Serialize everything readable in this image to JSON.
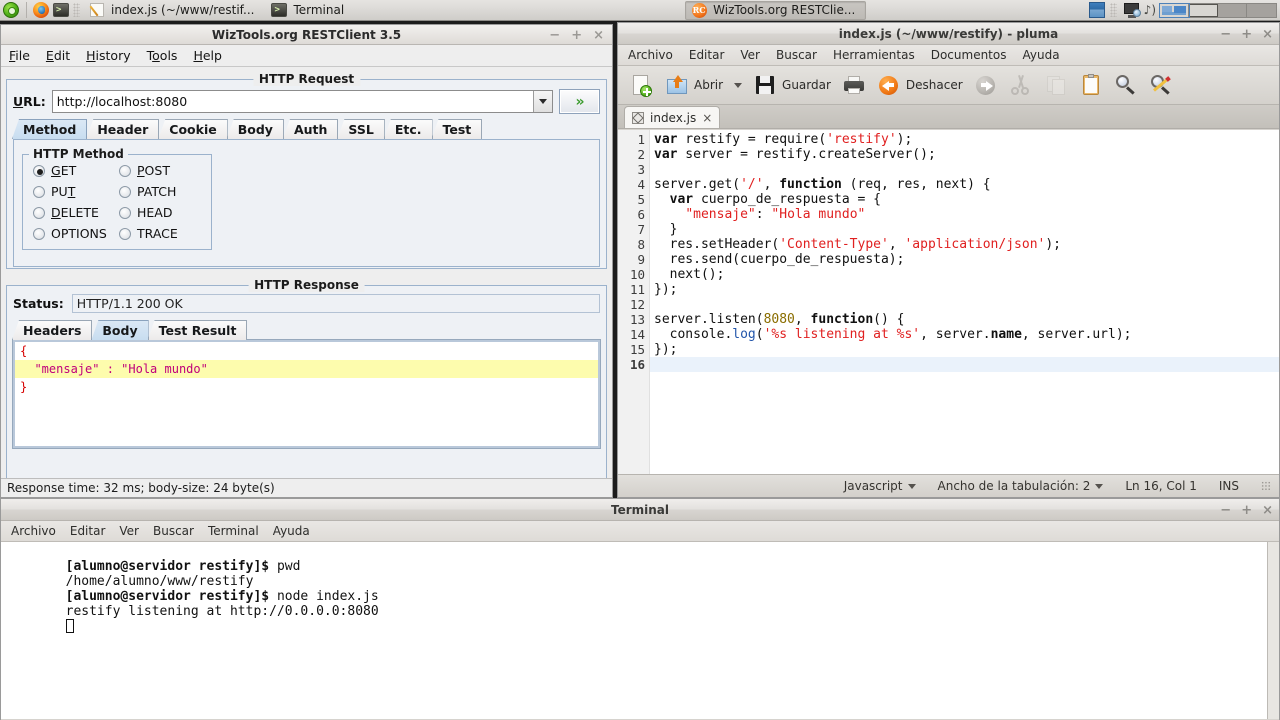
{
  "taskbar": {
    "start_tooltip": "Menu",
    "launchers": [
      {
        "name": "firefox-launcher",
        "label": "Firefox"
      },
      {
        "name": "terminal-launcher",
        "label": ">_"
      }
    ],
    "tasks": [
      {
        "label": "index.js (~/www/restif...",
        "icon": "pluma-icon",
        "active": false
      },
      {
        "label": "Terminal",
        "icon": "terminal-icon",
        "active": false
      },
      {
        "label": "WizTools.org RESTClie...",
        "icon": "restclient-icon",
        "active": true
      }
    ],
    "tray": {
      "volume_glyph": "◂))",
      "workspaces": [
        "1",
        "2",
        "3",
        "4"
      ],
      "active_workspace": 1
    }
  },
  "restclient": {
    "title": "WizTools.org RESTClient 3.5",
    "window_buttons": {
      "minimize": "−",
      "maximize": "+",
      "close": "×"
    },
    "menu": [
      {
        "label": "File",
        "mnemonic": "F"
      },
      {
        "label": "Edit",
        "mnemonic": "E"
      },
      {
        "label": "History",
        "mnemonic": "H"
      },
      {
        "label": "Tools",
        "mnemonic": "o"
      },
      {
        "label": "Help",
        "mnemonic": "H"
      }
    ],
    "request": {
      "group_title": "HTTP Request",
      "url_label": "URL:",
      "url_value": "http://localhost:8080",
      "url_placeholder": "http://",
      "send_label": "»",
      "tabs": [
        {
          "label": "Method",
          "selected": true
        },
        {
          "label": "Header",
          "selected": false
        },
        {
          "label": "Cookie",
          "selected": false
        },
        {
          "label": "Body",
          "selected": false
        },
        {
          "label": "Auth",
          "selected": false
        },
        {
          "label": "SSL",
          "selected": false
        },
        {
          "label": "Etc.",
          "selected": false
        },
        {
          "label": "Test",
          "selected": false
        }
      ],
      "method_group_title": "HTTP Method",
      "methods": [
        {
          "label": "GET",
          "selected": true
        },
        {
          "label": "POST",
          "selected": false
        },
        {
          "label": "PUT",
          "selected": false
        },
        {
          "label": "PATCH",
          "selected": false
        },
        {
          "label": "DELETE",
          "selected": false
        },
        {
          "label": "HEAD",
          "selected": false
        },
        {
          "label": "OPTIONS",
          "selected": false
        },
        {
          "label": "TRACE",
          "selected": false
        }
      ]
    },
    "response": {
      "group_title": "HTTP Response",
      "status_label": "Status:",
      "status_value": "HTTP/1.1 200 OK",
      "tabs": [
        {
          "label": "Headers",
          "selected": false
        },
        {
          "label": "Body",
          "selected": true
        },
        {
          "label": "Test Result",
          "selected": false
        }
      ],
      "body_lines": [
        {
          "text": "{",
          "kind": "brace",
          "highlight": false
        },
        {
          "text": "  \"mensaje\" : \"Hola mundo\"",
          "kind": "kv",
          "highlight": true
        },
        {
          "text": "}",
          "kind": "brace",
          "highlight": false
        }
      ]
    },
    "statusbar": "Response time: 32 ms; body-size: 24 byte(s)"
  },
  "pluma": {
    "title": "index.js (~/www/restify) - pluma",
    "window_buttons": {
      "minimize": "−",
      "maximize": "+",
      "close": "×"
    },
    "menu": [
      "Archivo",
      "Editar",
      "Ver",
      "Buscar",
      "Herramientas",
      "Documentos",
      "Ayuda"
    ],
    "toolbar": [
      {
        "name": "new-document-button",
        "label": "",
        "icon": "new-document-icon",
        "enabled": true
      },
      {
        "name": "open-button",
        "label": "Abrir",
        "icon": "open-folder-icon",
        "enabled": true
      },
      {
        "name": "open-dropdown-button",
        "label": "▼",
        "icon": "chevron-down-icon",
        "enabled": true
      },
      {
        "name": "save-button",
        "label": "Guardar",
        "icon": "save-icon",
        "enabled": true
      },
      {
        "name": "print-button",
        "label": "",
        "icon": "print-icon",
        "enabled": true
      },
      {
        "name": "undo-button",
        "label": "Deshacer",
        "icon": "undo-icon",
        "enabled": true
      },
      {
        "name": "redo-button",
        "label": "",
        "icon": "redo-icon",
        "enabled": false
      },
      {
        "name": "cut-button",
        "label": "",
        "icon": "cut-icon",
        "enabled": false
      },
      {
        "name": "copy-button",
        "label": "",
        "icon": "copy-icon",
        "enabled": false
      },
      {
        "name": "paste-button",
        "label": "",
        "icon": "paste-icon",
        "enabled": true
      },
      {
        "name": "find-button",
        "label": "",
        "icon": "find-icon",
        "enabled": true
      },
      {
        "name": "replace-button",
        "label": "",
        "icon": "replace-icon",
        "enabled": true
      }
    ],
    "tab": {
      "label": "index.js",
      "close_glyph": "×"
    },
    "code_lines": [
      {
        "n": 1,
        "text": "var restify = require('restify');"
      },
      {
        "n": 2,
        "text": "var server = restify.createServer();"
      },
      {
        "n": 3,
        "text": ""
      },
      {
        "n": 4,
        "text": "server.get('/', function (req, res, next) {"
      },
      {
        "n": 5,
        "text": "  var cuerpo_de_respuesta = {"
      },
      {
        "n": 6,
        "text": "    \"mensaje\": \"Hola mundo\""
      },
      {
        "n": 7,
        "text": "  }"
      },
      {
        "n": 8,
        "text": "  res.setHeader('Content-Type', 'application/json');"
      },
      {
        "n": 9,
        "text": "  res.send(cuerpo_de_respuesta);"
      },
      {
        "n": 10,
        "text": "  next();"
      },
      {
        "n": 11,
        "text": "});"
      },
      {
        "n": 12,
        "text": ""
      },
      {
        "n": 13,
        "text": "server.listen(8080, function() {"
      },
      {
        "n": 14,
        "text": "  console.log('%s listening at %s', server.name, server.url);"
      },
      {
        "n": 15,
        "text": "});"
      },
      {
        "n": 16,
        "text": "",
        "current": true
      }
    ],
    "statusbar": {
      "language": "Javascript",
      "tab_width": "Ancho de la tabulación: 2",
      "cursor": "Ln 16, Col 1",
      "insert_mode": "INS"
    }
  },
  "terminal": {
    "title": "Terminal",
    "window_buttons": {
      "minimize": "−",
      "maximize": "+",
      "close": "×"
    },
    "menu": [
      "Archivo",
      "Editar",
      "Ver",
      "Buscar",
      "Terminal",
      "Ayuda"
    ],
    "lines": [
      {
        "prompt": "[alumno@servidor restify]$",
        "command": " pwd"
      },
      {
        "prompt": "",
        "command": "/home/alumno/www/restify"
      },
      {
        "prompt": "[alumno@servidor restify]$",
        "command": " node index.js"
      },
      {
        "prompt": "",
        "command": "restify listening at http://0.0.0.0:8080"
      }
    ]
  },
  "colors": {
    "accent_green": "#3b9b2e",
    "selection_yellow": "#fdfcad",
    "json_brace_red": "#d60000",
    "json_kv_magenta": "#c0007a",
    "code_string_red": "#e02020",
    "current_line_blue": "#eaf2fb"
  }
}
